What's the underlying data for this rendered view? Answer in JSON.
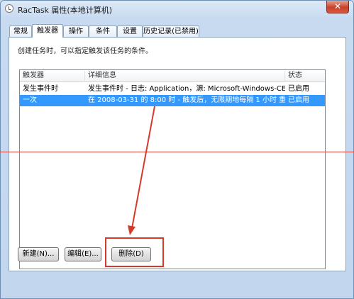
{
  "window": {
    "title": "RacTask 属性(本地计算机)",
    "close_label": "✕"
  },
  "tabs": [
    {
      "label": "常规",
      "active": false
    },
    {
      "label": "触发器",
      "active": true
    },
    {
      "label": "操作",
      "active": false
    },
    {
      "label": "条件",
      "active": false
    },
    {
      "label": "设置",
      "active": false
    },
    {
      "label": "历史记录(已禁用)",
      "active": false
    }
  ],
  "trigger_panel": {
    "description": "创建任务时，可以指定触发该任务的条件。",
    "columns": [
      "触发器",
      "详细信息",
      "状态"
    ],
    "rows": [
      {
        "trigger": "发生事件时",
        "details": "发生事件时 - 日志: Application，源: Microsoft-Windows-CEI...",
        "status": "已启用",
        "selected": false
      },
      {
        "trigger": "一次",
        "details": "在 2008-03-31 的 8:00 时 - 触发后，无限期地每隔 1 小时 重...",
        "status": "已启用",
        "selected": true
      }
    ]
  },
  "buttons": {
    "new": "新建(N)...",
    "edit": "编辑(E)...",
    "delete": "删除(D)"
  },
  "colors": {
    "annotation": "#d23a2b",
    "selection": "#3399ff"
  }
}
